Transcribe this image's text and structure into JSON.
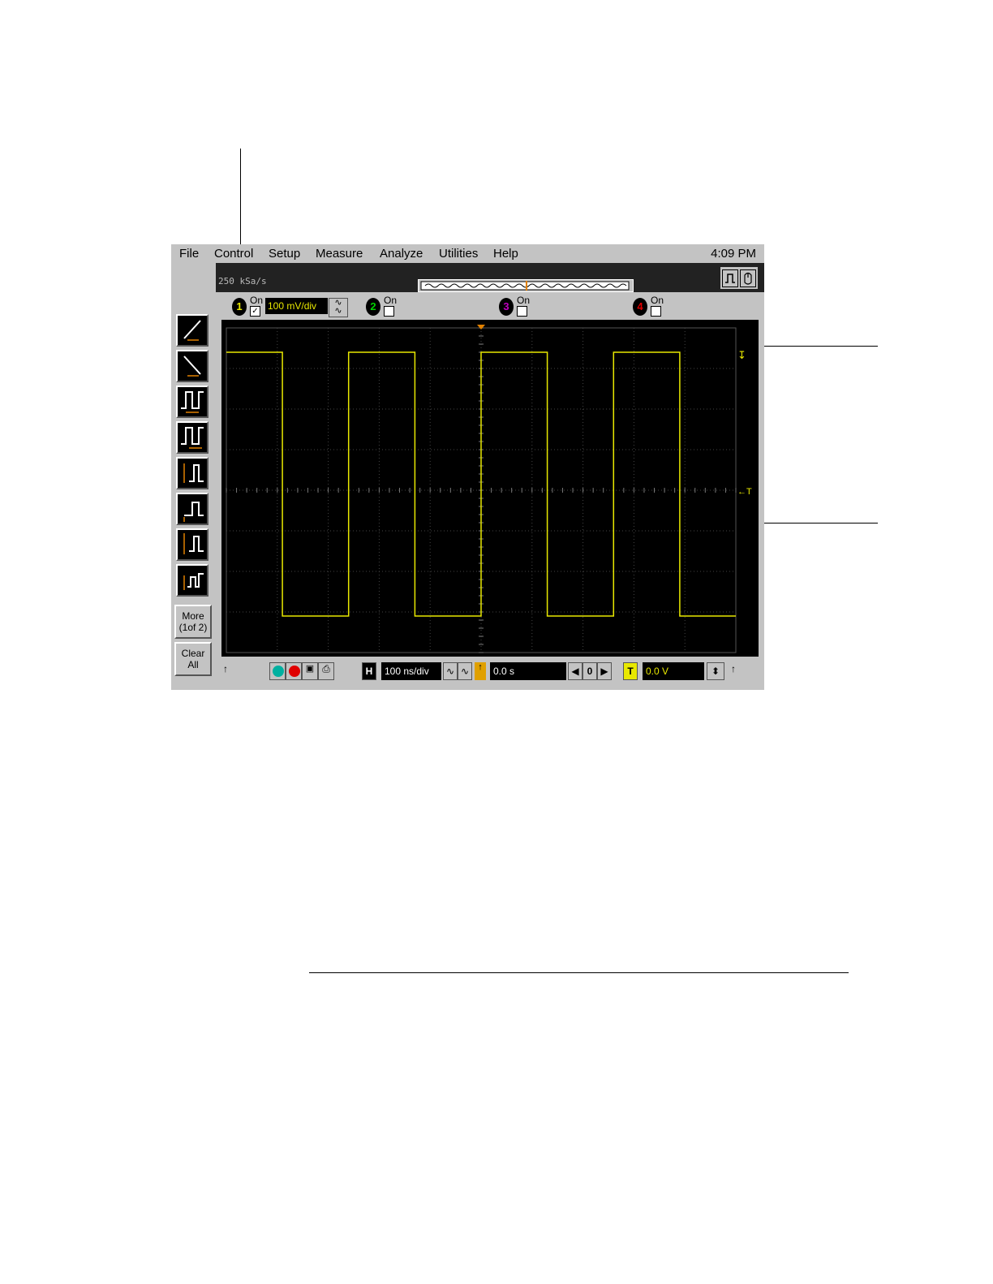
{
  "menubar": {
    "items": [
      "File",
      "Control",
      "Setup",
      "Measure",
      "Analyze",
      "Utilities",
      "Help"
    ],
    "clock": "4:09 PM"
  },
  "status": {
    "sample_rate": "250 kSa/s"
  },
  "toolbar_left": {
    "more_label_line1": "More",
    "more_label_line2": "(1of 2)",
    "clear_label_line1": "Clear",
    "clear_label_line2": "All",
    "measure_icons": [
      "rise-time-icon",
      "fall-time-icon",
      "period-icon",
      "frequency-icon",
      "vpp-icon",
      "vmin-icon",
      "vmax-icon",
      "vavg-icon"
    ]
  },
  "channels": [
    {
      "number": "1",
      "on_label": "On",
      "checked": true,
      "scale": "100 mV/div",
      "color": "#e8e800"
    },
    {
      "number": "2",
      "on_label": "On",
      "checked": false,
      "color": "#00d000"
    },
    {
      "number": "3",
      "on_label": "On",
      "checked": false,
      "color": "#c000c0"
    },
    {
      "number": "4",
      "on_label": "On",
      "checked": false,
      "color": "#e00000"
    }
  ],
  "display": {
    "trace_color": "#e8e800",
    "grid_color": "#444444",
    "trigger_marker": "←T",
    "ground_marker": "↧",
    "divisions_x": 10,
    "divisions_y": 8
  },
  "bottom": {
    "h_label": "H",
    "timebase": "100 ns/div",
    "delay": "0.0 s",
    "zero_label": "0",
    "t_label": "T",
    "trigger_level": "0.0 V"
  },
  "chart_data": {
    "type": "line",
    "series": [
      {
        "values_desc": "square wave",
        "x_div": [
          0.0,
          1.1,
          1.1,
          2.4,
          2.4,
          3.7,
          3.7,
          5.0,
          5.0,
          6.3,
          6.3,
          7.6,
          7.6,
          8.9,
          8.9,
          10.0
        ],
        "y_div": [
          3.4,
          3.4,
          -3.1,
          -3.1,
          3.4,
          3.4,
          -3.1,
          -3.1,
          3.4,
          3.4,
          -3.1,
          -3.1,
          3.4,
          3.4,
          -3.1,
          -3.1
        ]
      }
    ],
    "xlim": [
      0,
      10
    ],
    "ylim": [
      -4,
      4
    ],
    "grid": true
  }
}
